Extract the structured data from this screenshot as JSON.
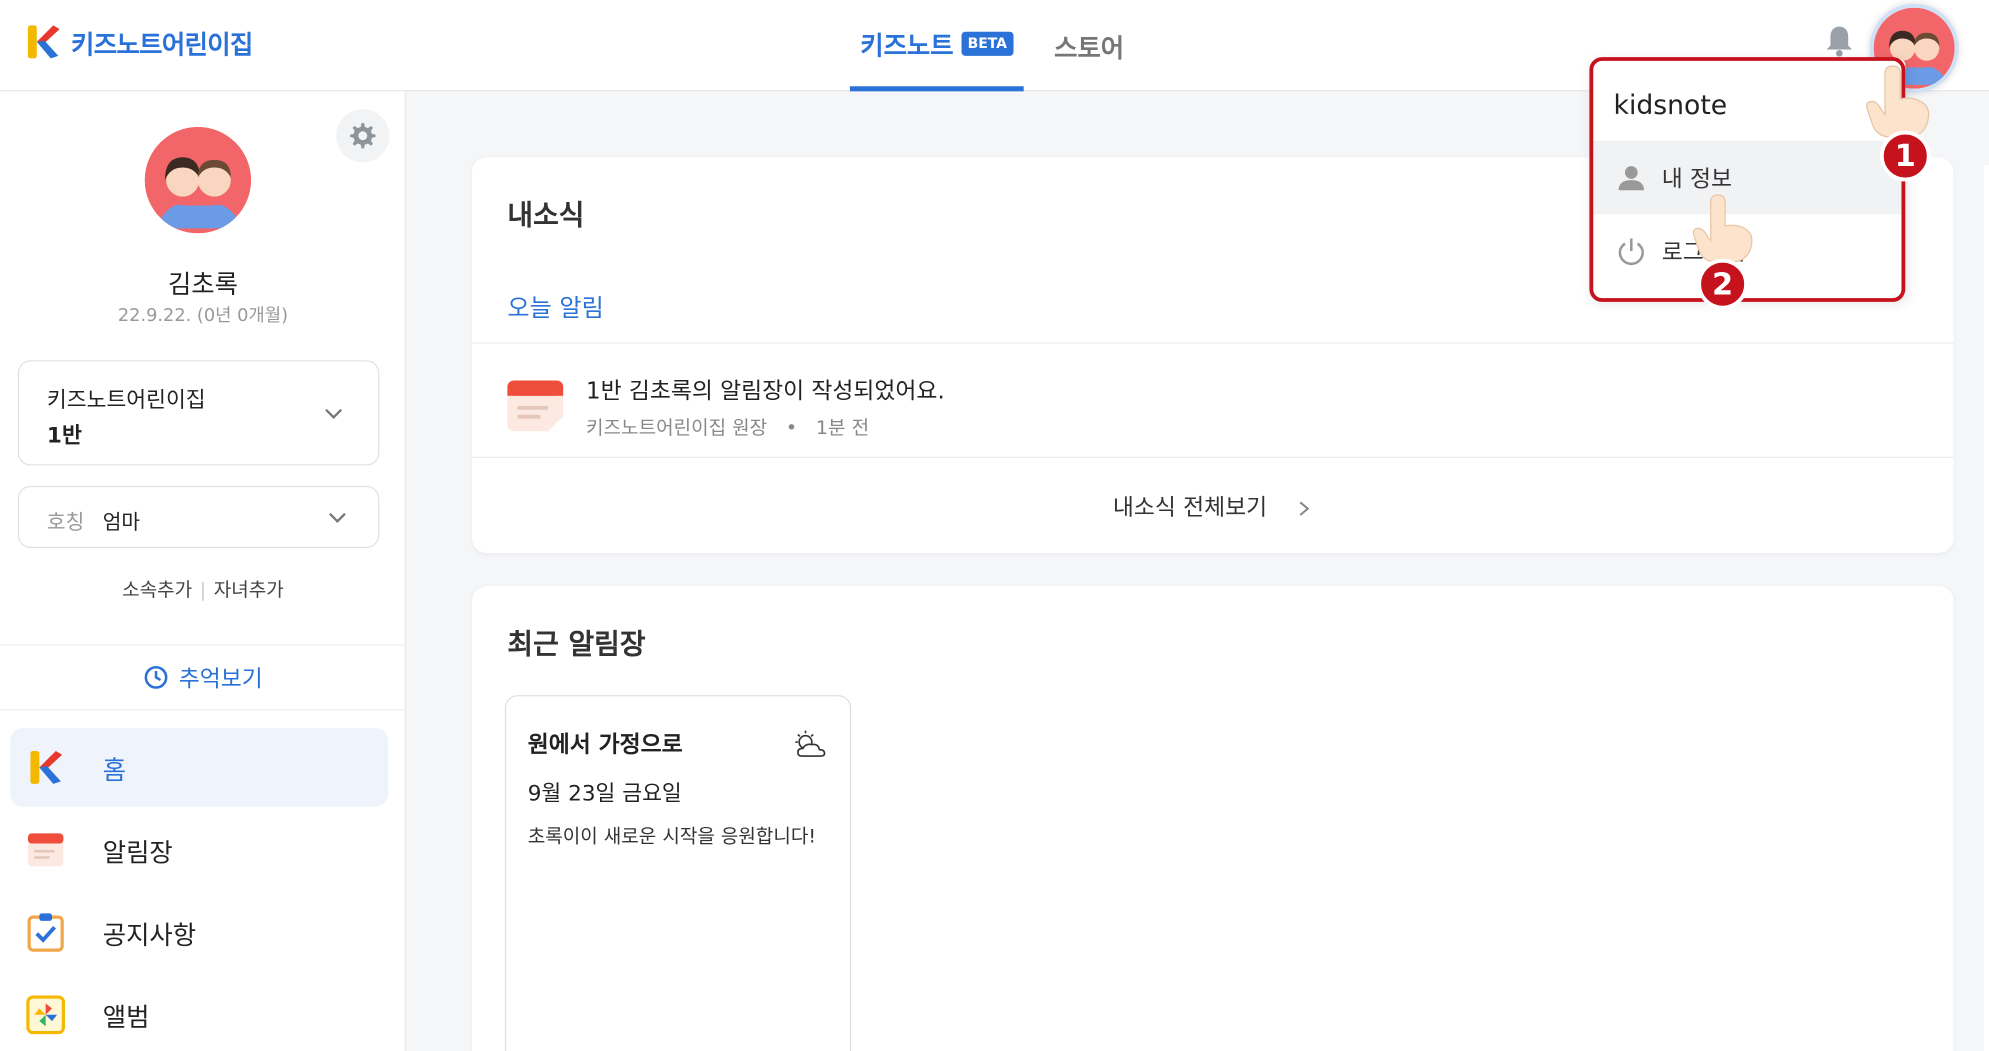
{
  "header": {
    "brand": "키즈노트어린이집",
    "tabs": [
      {
        "label": "키즈노트",
        "badge": "BETA"
      },
      {
        "label": "스토어"
      }
    ]
  },
  "profile": {
    "name": "김초록",
    "birth": "22.9.22. (0년 0개월)",
    "school": "키즈노트어린이집",
    "class": "1반",
    "title_label": "호칭",
    "title_value": "엄마",
    "link_affiliation": "소속추가",
    "link_child": "자녀추가",
    "memory": "추억보기"
  },
  "nav": {
    "items": [
      {
        "label": "홈",
        "icon": "kidsnote-logo-icon"
      },
      {
        "label": "알림장",
        "icon": "calendar-note-icon"
      },
      {
        "label": "공지사항",
        "icon": "checklist-icon"
      },
      {
        "label": "앨범",
        "icon": "pinwheel-icon"
      }
    ]
  },
  "news": {
    "title": "내소식",
    "today_label": "오늘 알림",
    "notification": {
      "text": "1반 김초록의 알림장이 작성되었어요.",
      "author": "키즈노트어린이집 원장",
      "dot": "•",
      "time": "1분 전"
    },
    "view_all": "내소식 전체보기"
  },
  "recent": {
    "title": "최근 알림장",
    "note": {
      "title": "원에서 가정으로",
      "date": "9월 23일 금요일",
      "body": "초록이이 새로운 시작을 응원합니다!"
    }
  },
  "dropdown": {
    "user": "kidsnote",
    "items": [
      {
        "label": "내 정보",
        "icon": "person-icon"
      },
      {
        "label": "로그아웃",
        "icon": "power-icon"
      }
    ]
  },
  "annotations": {
    "step1": "1",
    "step2": "2"
  },
  "colors": {
    "accent": "#2a71d8",
    "highlight": "#c5121c"
  }
}
